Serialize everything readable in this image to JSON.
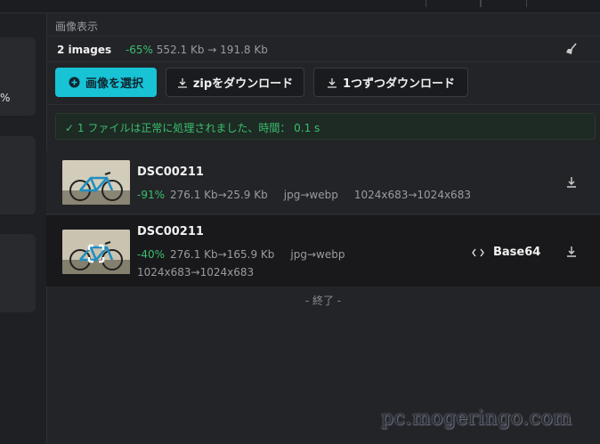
{
  "section_title": "画像表示",
  "left_rail": {
    "percent": "%"
  },
  "stats": {
    "count": "2 images",
    "percent": "-65%",
    "from_size": "552.1 Kb",
    "to_size": "191.8 Kb"
  },
  "toolbar": {
    "select_label": "画像を選択",
    "zip_label": "zipをダウンロード",
    "each_label": "1つずつダウンロード"
  },
  "status_message": "✓ 1 ファイルは正常に処理されました、時間： 0.1 s",
  "files": [
    {
      "name": "DSC00211",
      "percent": "-91%",
      "size": "276.1 Kb→25.9 Kb",
      "format": "jpg→webp",
      "dimensions": "1024x683→1024x683"
    },
    {
      "name": "DSC00211",
      "percent": "-40%",
      "size": "276.1 Kb→165.9 Kb",
      "format": "jpg→webp",
      "dimensions": "1024x683→1024x683",
      "base64_label": "Base64"
    }
  ],
  "end_label": "- 終了 -",
  "watermark": "pc.mogeringo.com",
  "colors": {
    "accent": "#18c3d6",
    "success": "#3bbf6e",
    "background": "#232427"
  }
}
